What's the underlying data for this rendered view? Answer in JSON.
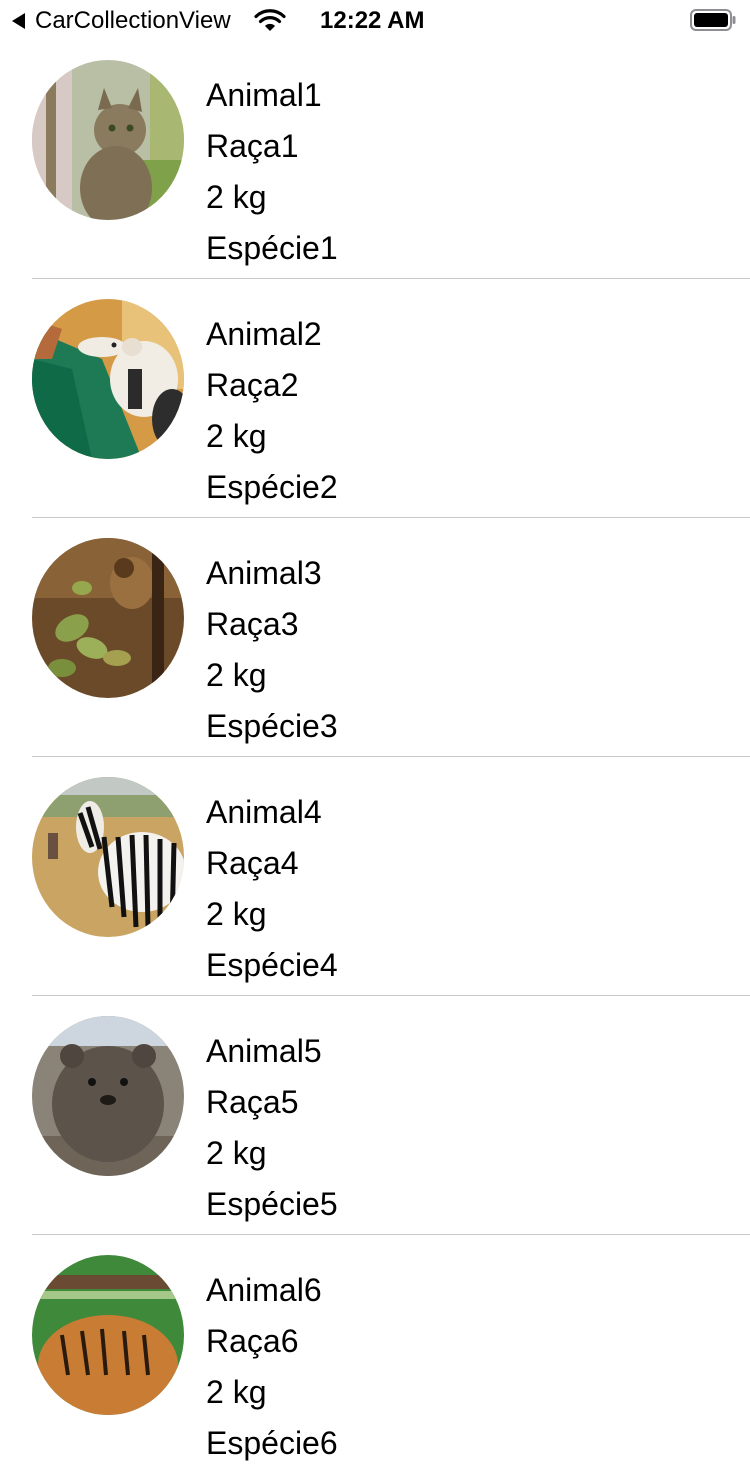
{
  "status_bar": {
    "back_label": "CarCollectionView",
    "time": "12:22 AM",
    "icons": [
      "back-arrow-icon",
      "wifi-icon",
      "battery-icon"
    ]
  },
  "animals": [
    {
      "name": "Animal1",
      "breed": "Raça1",
      "weight": "2 kg",
      "species": "Espécie1",
      "photo": "wildcat-photo"
    },
    {
      "name": "Animal2",
      "breed": "Raça2",
      "weight": "2 kg",
      "species": "Espécie2",
      "photo": "anteater-photo"
    },
    {
      "name": "Animal3",
      "breed": "Raça3",
      "weight": "2 kg",
      "species": "Espécie3",
      "photo": "monkey-photo"
    },
    {
      "name": "Animal4",
      "breed": "Raça4",
      "weight": "2 kg",
      "species": "Espécie4",
      "photo": "zebra-photo"
    },
    {
      "name": "Animal5",
      "breed": "Raça5",
      "weight": "2 kg",
      "species": "Espécie5",
      "photo": "quokka-photo"
    },
    {
      "name": "Animal6",
      "breed": "Raça6",
      "weight": "2 kg",
      "species": "Espécie6",
      "photo": "tiger-photo"
    }
  ]
}
